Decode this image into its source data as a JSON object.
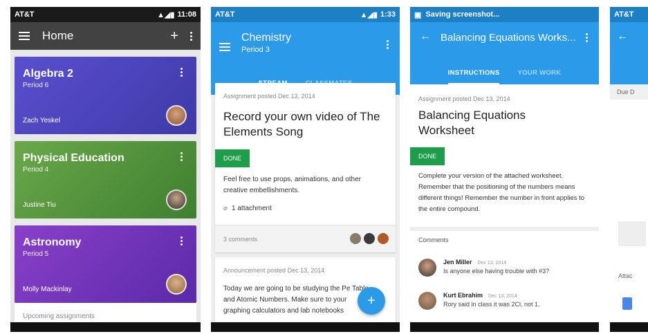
{
  "phone1": {
    "status": {
      "carrier": "AT&T",
      "time": "11:08"
    },
    "appbar": {
      "title": "Home"
    },
    "classes": [
      {
        "name": "Algebra 2",
        "period": "Period 6",
        "teacher": "Zach Yeskel"
      },
      {
        "name": "Physical Education",
        "period": "Period 4",
        "teacher": "Justine Tiu"
      },
      {
        "name": "Astronomy",
        "period": "Period 5",
        "teacher": "Molly Mackinlay"
      }
    ],
    "upcoming": "Upcoming assignments"
  },
  "phone2": {
    "status": {
      "carrier": "AT&T",
      "time": "1:33"
    },
    "appbar": {
      "title": "Chemistry",
      "subtitle": "Period 3"
    },
    "tabs": [
      "STREAM",
      "CLASSMATES"
    ],
    "assignment": {
      "meta": "Assignment posted Dec 13, 2014",
      "title": "Record your own video of The Elements Song",
      "status": "DONE",
      "body": "Feel free to use props, animations, and other creative embellishments.",
      "attachments": "1 attachment",
      "comments": "3 comments"
    },
    "announcement": {
      "meta": "Announcement posted Dec 13, 2014",
      "body": "Today we are going to be studying the Pe Table and Atomic Numbers. Make sure to your graphing calculators and lab notebooks"
    },
    "fab": "+"
  },
  "phone3": {
    "status": {
      "text": "Saving screenshot..."
    },
    "appbar": {
      "title": "Balancing Equations Works..."
    },
    "tabs": [
      "INSTRUCTIONS",
      "YOUR WORK"
    ],
    "meta": "Assignment posted Dec 13, 2014",
    "title": "Balancing Equations Worksheet",
    "status_badge": "DONE",
    "body": "Complete your version of the attached worksheet. Remember that the positioning of the numbers means different things! Remember the number in front applies to the entire compound.",
    "comments_header": "Comments",
    "comments": [
      {
        "name": "Jen Miller",
        "date": "Dec 13, 2014",
        "text": "Is anyone else having trouble with #3?"
      },
      {
        "name": "Kurt Ebrahim",
        "date": "Dec 13, 2014",
        "text": "Rory said in class it was 2Cl, not 1."
      }
    ]
  },
  "phone4": {
    "status": {
      "carrier": "AT&T"
    },
    "due": "Due D",
    "attach": "Attac"
  },
  "colors": {
    "blue": "#2b9ae8",
    "green": "#1e9e4a",
    "dark_bar": "#424242"
  }
}
